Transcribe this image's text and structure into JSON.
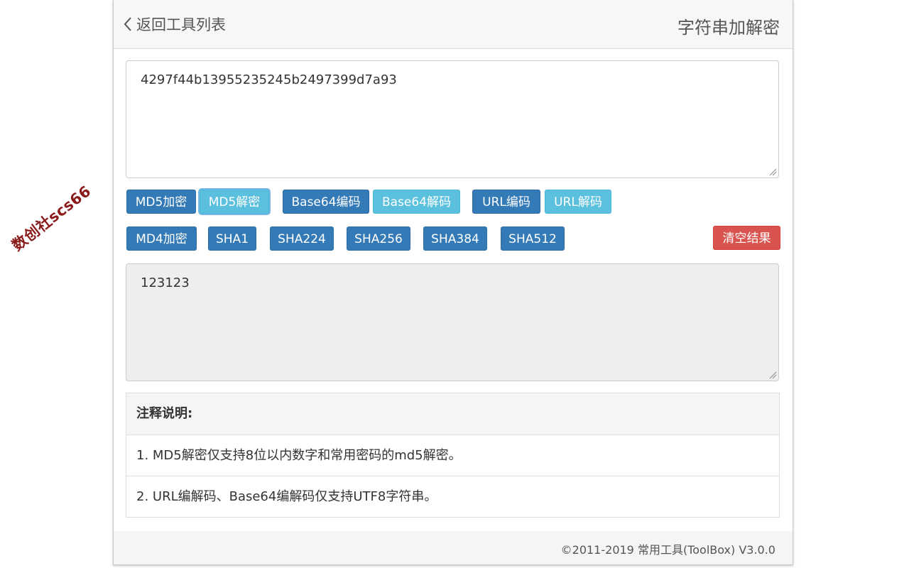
{
  "watermark": "数创社scs66",
  "header": {
    "back_label": "返回工具列表",
    "title": "字符串加解密"
  },
  "input": {
    "value": "4297f44b13955235245b2497399d7a93"
  },
  "buttons_row1": [
    {
      "label": "MD5加密",
      "style": "primary"
    },
    {
      "label": "MD5解密",
      "style": "info",
      "state": "focused"
    },
    {
      "label": "Base64编码",
      "style": "primary"
    },
    {
      "label": "Base64解码",
      "style": "info"
    },
    {
      "label": "URL编码",
      "style": "primary"
    },
    {
      "label": "URL解码",
      "style": "info"
    }
  ],
  "buttons_row2": [
    {
      "label": "MD4加密",
      "style": "primary"
    },
    {
      "label": "SHA1",
      "style": "primary"
    },
    {
      "label": "SHA224",
      "style": "primary"
    },
    {
      "label": "SHA256",
      "style": "primary"
    },
    {
      "label": "SHA384",
      "style": "primary"
    },
    {
      "label": "SHA512",
      "style": "primary"
    },
    {
      "label": "清空结果",
      "style": "danger"
    }
  ],
  "output": {
    "value": "123123"
  },
  "notes": {
    "heading": "注释说明:",
    "items": [
      "1. MD5解密仅支持8位以内数字和常用密码的md5解密。",
      "2. URL编解码、Base64编解码仅支持UTF8字符串。"
    ]
  },
  "footer": {
    "text": "©2011-2019 常用工具(ToolBox) V3.0.0"
  },
  "colors": {
    "primary": "#337ab7",
    "info": "#5bc0de",
    "danger": "#d9534f",
    "watermark": "#8b1a1a"
  },
  "icons": [
    "chevron-left-icon",
    "resize-grip-icon"
  ]
}
